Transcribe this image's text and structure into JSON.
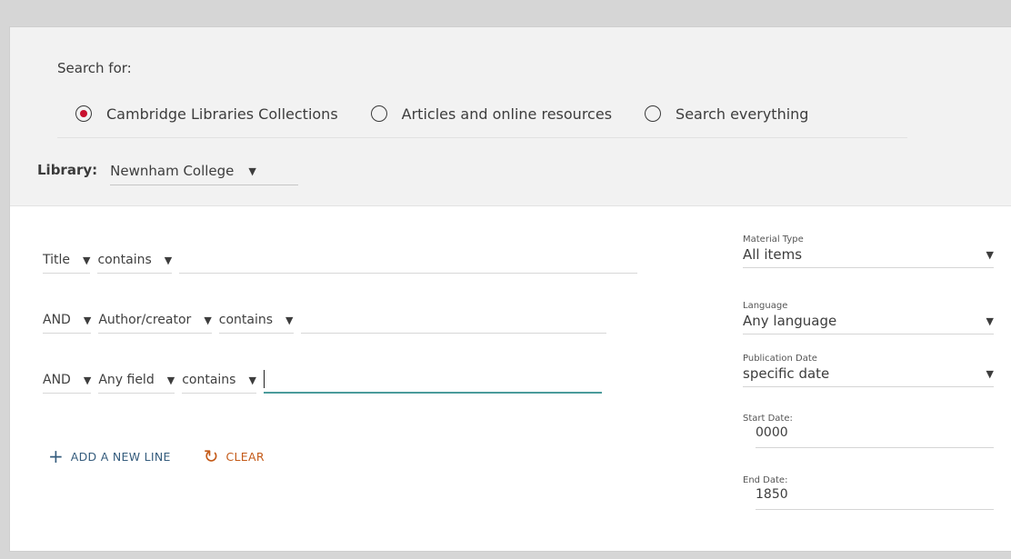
{
  "search_for": {
    "label": "Search for:",
    "scopes": [
      {
        "label": "Cambridge Libraries Collections",
        "selected": true
      },
      {
        "label": "Articles and online resources",
        "selected": false
      },
      {
        "label": "Search everything",
        "selected": false
      }
    ]
  },
  "library": {
    "label": "Library:",
    "value": "Newnham College"
  },
  "query_lines": [
    {
      "operator": "",
      "field": "Title",
      "condition": "contains",
      "value": ""
    },
    {
      "operator": "AND",
      "field": "Author/creator",
      "condition": "contains",
      "value": ""
    },
    {
      "operator": "AND",
      "field": "Any field",
      "condition": "contains",
      "value": ""
    }
  ],
  "actions": {
    "add_line": "ADD A NEW LINE",
    "clear": "CLEAR"
  },
  "filters": {
    "material_type": {
      "caption": "Material Type",
      "value": "All items"
    },
    "language": {
      "caption": "Language",
      "value": "Any language"
    },
    "publication_date": {
      "caption": "Publication Date",
      "value": "specific date"
    },
    "start_date": {
      "caption": "Start Date:",
      "value": "0000"
    },
    "end_date": {
      "caption": "End Date:",
      "value": "1850"
    }
  },
  "colors": {
    "radio_selected": "#c8102e",
    "add_line": "#355c7d",
    "clear": "#c45a18",
    "focus_underline": "#4b9b9b"
  },
  "icons": {
    "caret": "caret-down-icon",
    "add": "plus-icon",
    "clear": "refresh-icon"
  }
}
